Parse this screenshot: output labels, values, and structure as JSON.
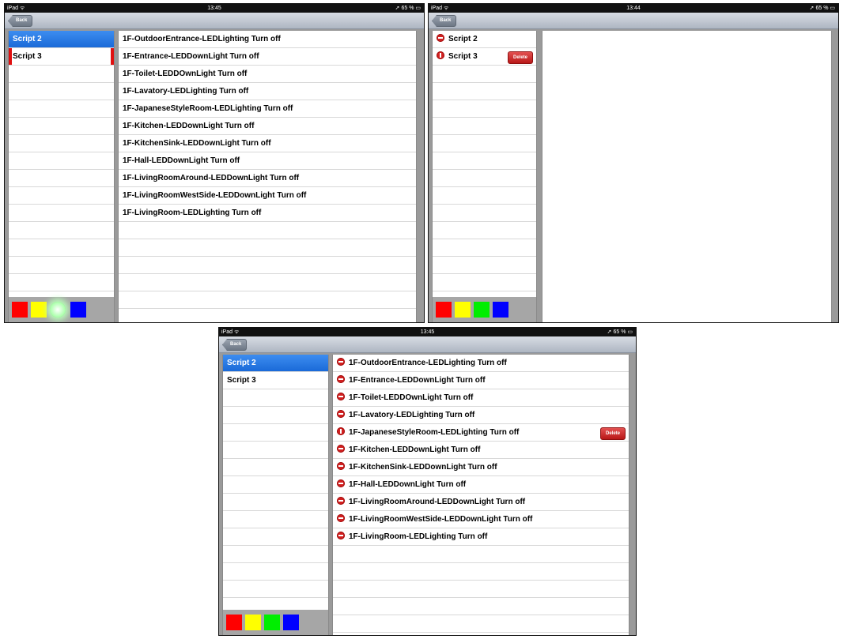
{
  "panels": [
    {
      "status": {
        "carrier": "iPad ᯤ",
        "time": "13:45",
        "battery": "➚ 65 % ▭"
      },
      "nav": {
        "back": "Back"
      },
      "scripts": [
        "Script 2",
        "Script 3"
      ],
      "actions": [
        "1F-OutdoorEntrance-LEDLighting  Turn off",
        "1F-Entrance-LEDDownLight  Turn off",
        "1F-Toilet-LEDDOwnLight  Turn off",
        "1F-Lavatory-LEDLighting  Turn off",
        "1F-JapaneseStyleRoom-LEDLighting  Turn off",
        "1F-Kitchen-LEDDownLight  Turn off",
        "1F-KitchenSink-LEDDownLight  Turn off",
        "1F-Hall-LEDDownLight  Turn off",
        "1F-LivingRoomAround-LEDDownLight  Turn off",
        "1F-LivingRoomWestSide-LEDDownLight  Turn off",
        "1F-LivingRoom-LEDLighting  Turn off"
      ]
    },
    {
      "status": {
        "carrier": "iPad ᯤ",
        "time": "13:44",
        "battery": "➚ 65 % ▭"
      },
      "nav": {
        "back": "Back"
      },
      "scripts": [
        "Script 2",
        "Script 3"
      ],
      "delete_label": "Delete"
    },
    {
      "status": {
        "carrier": "iPad ᯤ",
        "time": "13:45",
        "battery": "➚ 65 % ▭"
      },
      "nav": {
        "back": "Back"
      },
      "scripts": [
        "Script 2",
        "Script 3"
      ],
      "delete_label": "Delete",
      "actions": [
        "1F-OutdoorEntrance-LEDLighting  Turn off",
        "1F-Entrance-LEDDownLight  Turn off",
        "1F-Toilet-LEDDOwnLight  Turn off",
        "1F-Lavatory-LEDLighting  Turn off",
        "1F-JapaneseStyleRoom-LEDLighting  Turn off",
        "1F-Kitchen-LEDDownLight  Turn off",
        "1F-KitchenSink-LEDDownLight  Turn off",
        "1F-Hall-LEDDownLight  Turn off",
        "1F-LivingRoomAround-LEDDownLight  Turn off",
        "1F-LivingRoomWestSide-LEDDownLight  Turn off",
        "1F-LivingRoom-LEDLighting  Turn off"
      ]
    }
  ],
  "palette_colors": [
    "#ff0000",
    "#ffff00",
    "#00ee00",
    "#0000ff"
  ]
}
